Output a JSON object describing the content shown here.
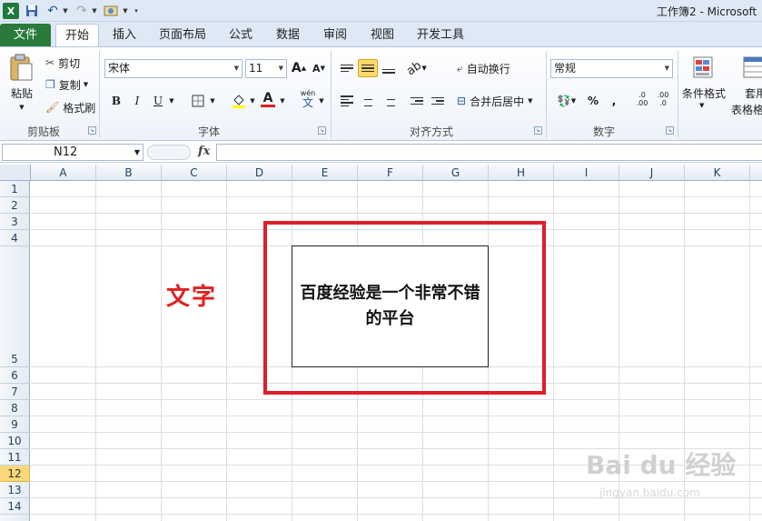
{
  "titlebar": {
    "title": "工作簿2 - Microsoft",
    "app_icon": "X"
  },
  "tabs": [
    {
      "label": "文件"
    },
    {
      "label": "开始"
    },
    {
      "label": "插入"
    },
    {
      "label": "页面布局"
    },
    {
      "label": "公式"
    },
    {
      "label": "数据"
    },
    {
      "label": "审阅"
    },
    {
      "label": "视图"
    },
    {
      "label": "开发工具"
    }
  ],
  "ribbon": {
    "clipboard": {
      "paste": "粘贴",
      "cut": "剪切",
      "copy": "复制",
      "format_painter": "格式刷",
      "group": "剪贴板"
    },
    "font": {
      "font_name": "宋体",
      "font_size": "11",
      "grow": "A",
      "shrink": "A",
      "bold": "B",
      "italic": "I",
      "underline": "U",
      "font_color": "A",
      "wen": "wén",
      "wen_char": "文",
      "group": "字体"
    },
    "alignment": {
      "wrap_text": "自动换行",
      "merge_center": "合并后居中",
      "group": "对齐方式"
    },
    "number": {
      "format": "常规",
      "percent": "%",
      "comma": ",",
      "inc": ".0",
      "inc2": ".00",
      "dec": ".00",
      "dec2": ".0",
      "group": "数字"
    },
    "styles": {
      "conditional_format": "条件格式",
      "table_format_top": "套用",
      "table_format": "表格格"
    }
  },
  "formula_bar": {
    "name_box": "N12",
    "fx": "fx",
    "content": ""
  },
  "sheet": {
    "columns": [
      "A",
      "B",
      "C",
      "D",
      "E",
      "F",
      "G",
      "H",
      "I",
      "J",
      "K"
    ],
    "rows": [
      "1",
      "2",
      "3",
      "4",
      "5",
      "6",
      "7",
      "8",
      "9",
      "10",
      "11",
      "12",
      "13",
      "14"
    ],
    "active_row": "12",
    "label": "文字",
    "textbox_text": "百度经验是一个非常不错的平台"
  },
  "watermark": {
    "brand": "Bai du 经验",
    "url": "jingyan.baidu.com"
  }
}
